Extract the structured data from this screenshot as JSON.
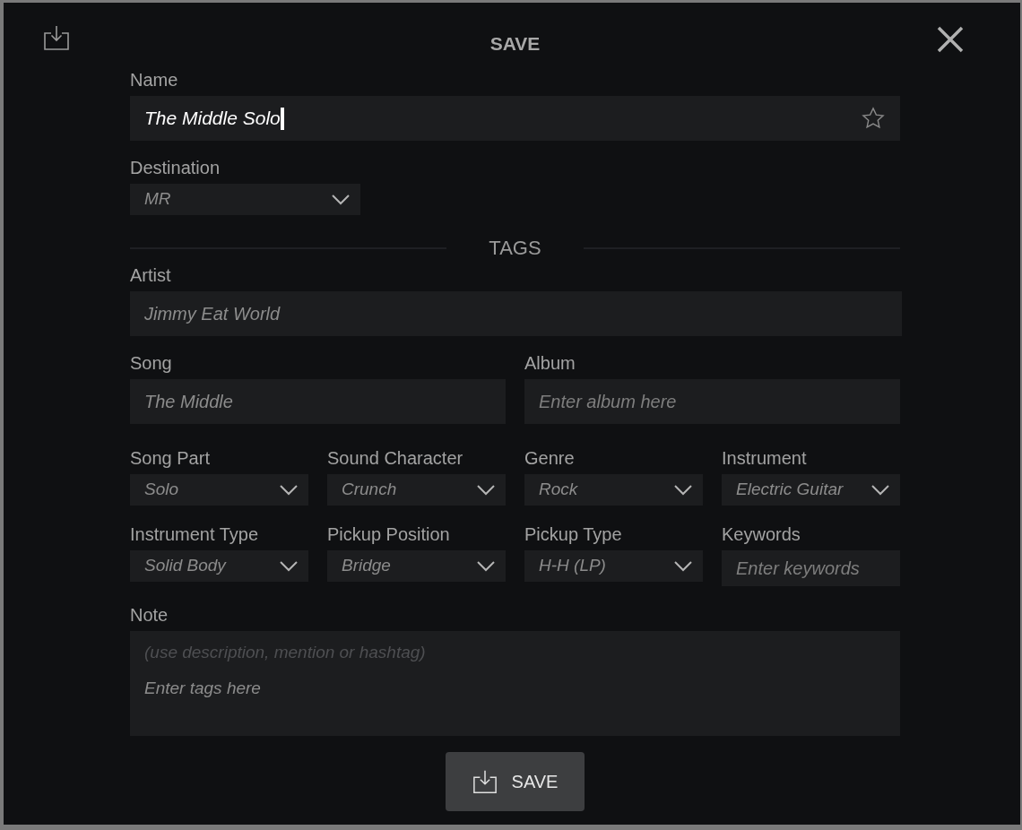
{
  "dialog": {
    "title": "SAVE"
  },
  "name_field": {
    "label": "Name",
    "value": "The Middle Solo",
    "favorite": false
  },
  "destination": {
    "label": "Destination",
    "value": "MR"
  },
  "tags_heading": "TAGS",
  "artist": {
    "label": "Artist",
    "value": "Jimmy Eat World"
  },
  "song_album": [
    {
      "label": "Song",
      "value": "The Middle"
    },
    {
      "label": "Album",
      "placeholder": "Enter album here"
    }
  ],
  "tag_fields": [
    {
      "kind": "dropdown",
      "label": "Song Part",
      "value": "Solo"
    },
    {
      "kind": "dropdown",
      "label": "Sound Character",
      "value": "Crunch"
    },
    {
      "kind": "dropdown",
      "label": "Genre",
      "value": "Rock"
    },
    {
      "kind": "dropdown",
      "label": "Instrument",
      "value": "Electric Guitar"
    },
    {
      "kind": "dropdown",
      "label": "Instrument Type",
      "value": "Solid Body"
    },
    {
      "kind": "dropdown",
      "label": "Pickup Position",
      "value": "Bridge"
    },
    {
      "kind": "dropdown",
      "label": "Pickup Type",
      "value": "H-H (LP)"
    },
    {
      "kind": "text",
      "label": "Keywords",
      "placeholder": "Enter keywords"
    }
  ],
  "note": {
    "label": "Note",
    "hint": "(use description, mention or hashtag)",
    "placeholder": "Enter tags here"
  },
  "save_button": {
    "label": "SAVE"
  }
}
